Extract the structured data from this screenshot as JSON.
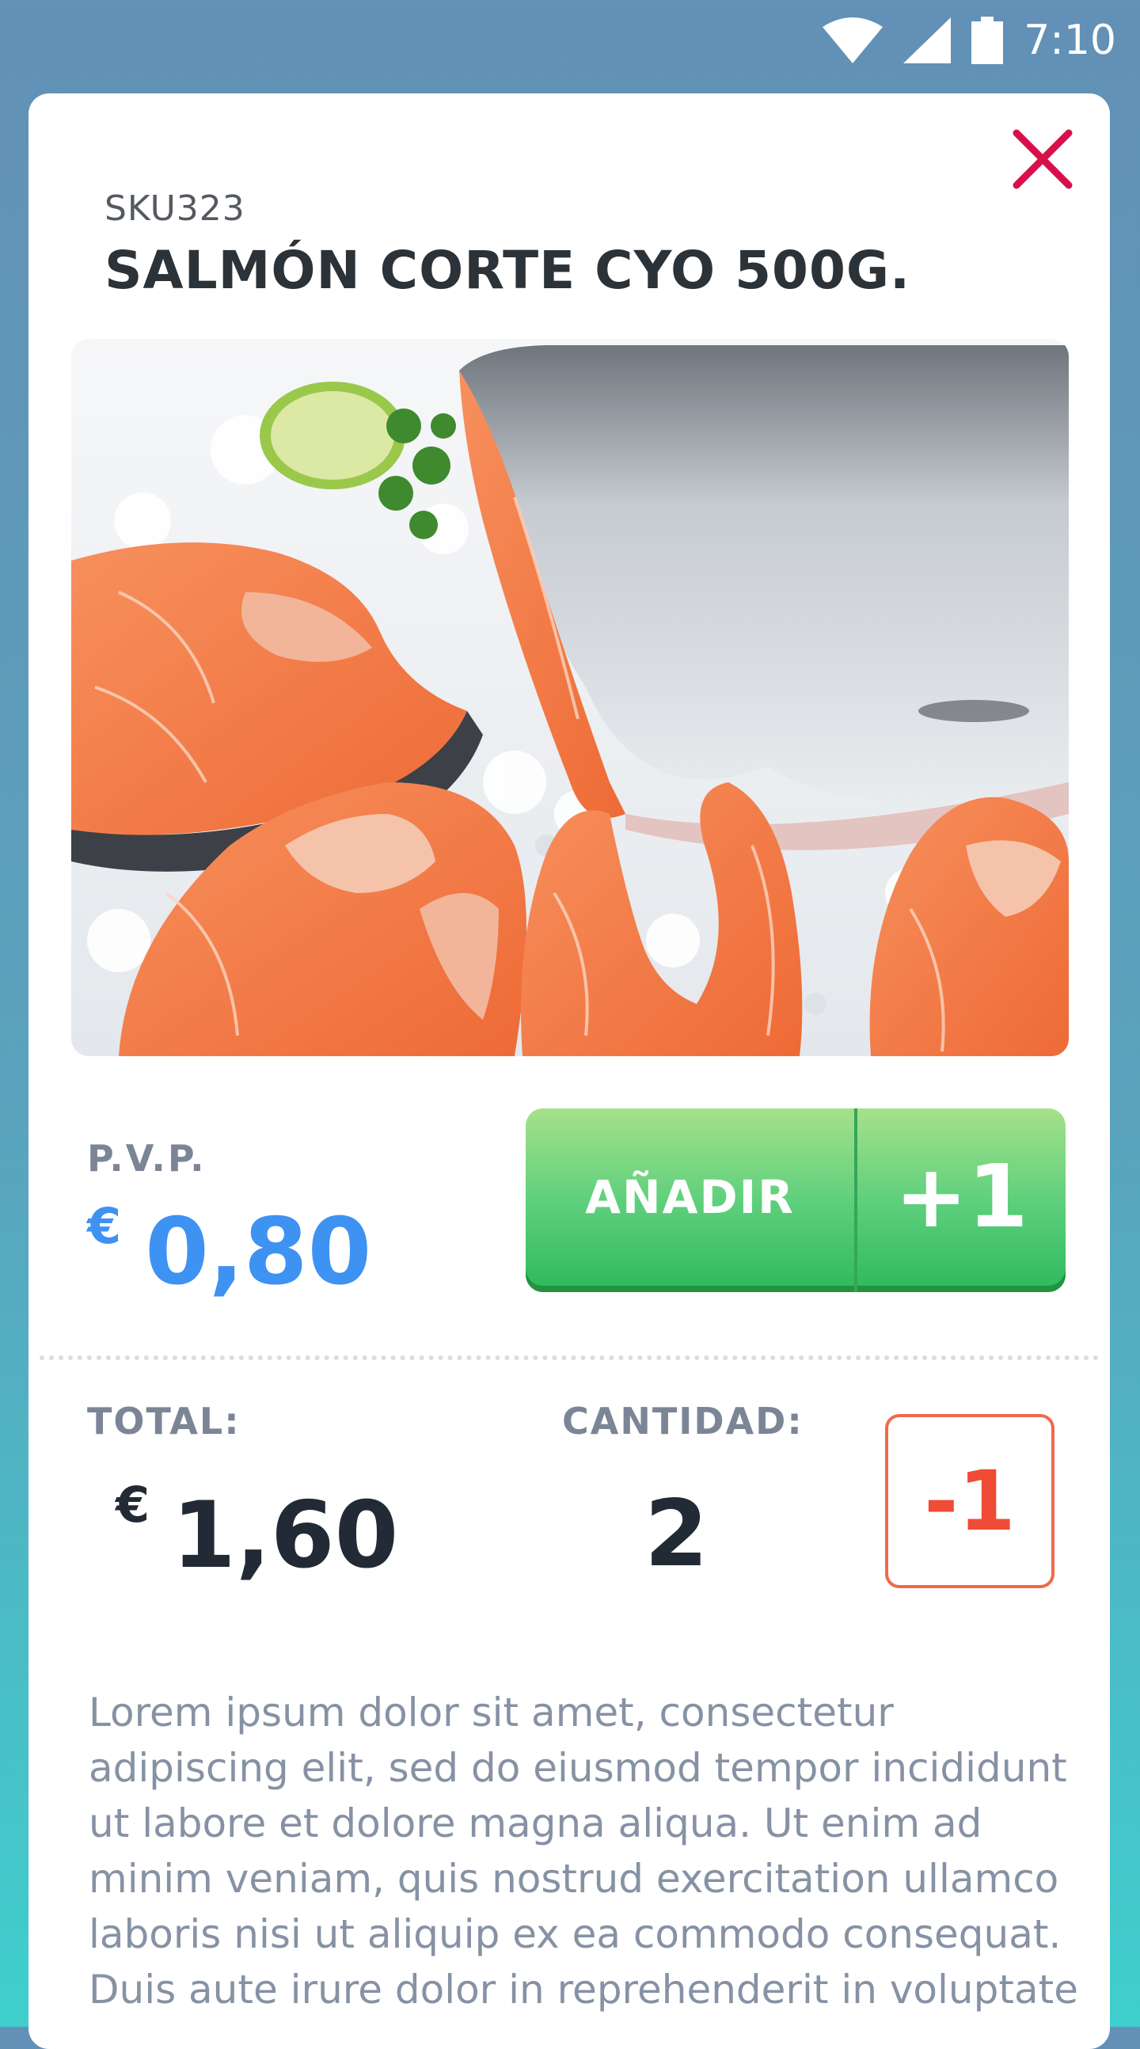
{
  "status_bar": {
    "time": "7:10",
    "icons": [
      "wifi-icon",
      "signal-icon",
      "battery-icon"
    ]
  },
  "product": {
    "sku": "SKU323",
    "title": "SALMÓN CORTE CYO 500G.",
    "image": "salmon-on-ice-photo"
  },
  "pricing": {
    "pvp_label": "P.V.P.",
    "currency": "€",
    "price": "0,80"
  },
  "actions": {
    "add_label": "AÑADIR",
    "plus_label": "+1",
    "minus_label": "-1"
  },
  "summary": {
    "total_label": "TOTAL:",
    "currency": "€",
    "total": "1,60",
    "quantity_label": "CANTIDAD:",
    "quantity": "2"
  },
  "description": "Lorem ipsum dolor sit amet, consectetur adipiscing elit, sed do eiusmod tempor incididunt ut labore et dolore magna aliqua. Ut enim ad minim veniam, quis nostrud exercitation ullamco laboris nisi ut aliquip ex ea commodo consequat. Duis aute irure dolor in reprehenderit in voluptate",
  "colors": {
    "accent_blue": "#3e92f1",
    "add_green": "#3fc668",
    "minus_red": "#ef4b35",
    "close_red": "#d8104a",
    "text_dark": "#222a35",
    "text_muted": "#7b8595"
  }
}
